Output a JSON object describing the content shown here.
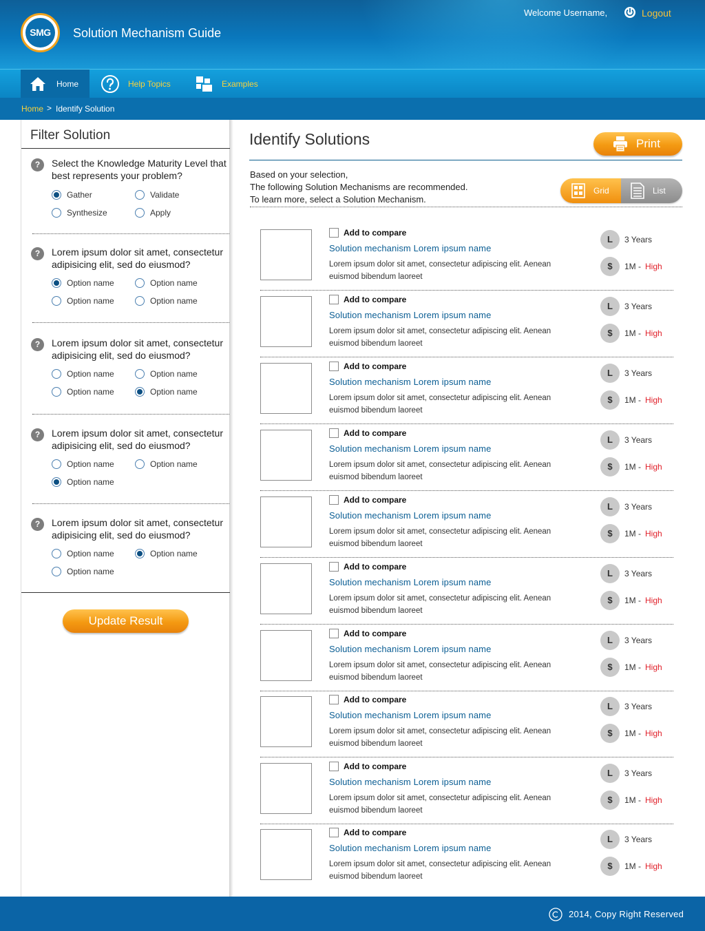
{
  "app": {
    "logo_text": "SMG",
    "title": "Solution Mechanism Guide",
    "welcome": "Welcome Username,",
    "logout": "Logout"
  },
  "nav": {
    "home": "Home",
    "help": "Help Topics",
    "examples": "Examples"
  },
  "breadcrumb": {
    "home": "Home",
    "separator": ">",
    "current": "Identify Solution"
  },
  "filter": {
    "title": "Filter Solution",
    "help_icon": "?",
    "questions": [
      {
        "text": "Select the Knowledge Maturity Level that best represents your problem?",
        "options": [
          {
            "label": "Gather",
            "selected": true
          },
          {
            "label": "Validate",
            "selected": false
          },
          {
            "label": "Synthesize",
            "selected": false
          },
          {
            "label": "Apply",
            "selected": false
          }
        ]
      },
      {
        "text": "Lorem ipsum dolor sit amet, consectetur adipisicing elit, sed do eiusmod?",
        "options": [
          {
            "label": "Option name",
            "selected": true
          },
          {
            "label": "Option name",
            "selected": false
          },
          {
            "label": "Option name",
            "selected": false
          },
          {
            "label": "Option name",
            "selected": false
          }
        ]
      },
      {
        "text": "Lorem ipsum dolor sit amet, consectetur adipisicing elit, sed do eiusmod?",
        "options": [
          {
            "label": "Option name",
            "selected": false
          },
          {
            "label": "Option name",
            "selected": false
          },
          {
            "label": "Option name",
            "selected": false
          },
          {
            "label": "Option name",
            "selected": true
          }
        ]
      },
      {
        "text": "Lorem ipsum dolor sit amet, consectetur adipisicing elit, sed do eiusmod?",
        "options": [
          {
            "label": "Option name",
            "selected": false
          },
          {
            "label": "Option name",
            "selected": false
          },
          {
            "label": "Option name",
            "selected": true
          }
        ]
      },
      {
        "text": "Lorem ipsum dolor sit amet, consectetur adipisicing elit, sed do eiusmod?",
        "options": [
          {
            "label": "Option name",
            "selected": false
          },
          {
            "label": "Option name",
            "selected": true
          },
          {
            "label": "Option name",
            "selected": false
          }
        ]
      }
    ],
    "update_button": "Update Result"
  },
  "main": {
    "title": "Identify Solutions",
    "print": "Print",
    "intro": [
      "Based on your selection,",
      "The following Solution Mechanisms are recommended.",
      "To learn more, select a Solution Mechanism."
    ],
    "view_grid": "Grid",
    "view_list": "List",
    "active_view": "Grid"
  },
  "results": [
    {
      "compare": "Add to compare",
      "title": "Solution mechanism Lorem ipsum name",
      "desc": "Lorem ipsum dolor sit amet, consectetur adipiscing elit. Aenean euismod bibendum laoreet",
      "duration": "3 Years",
      "cost": "1M -",
      "level": "High",
      "clock_glyph": "L",
      "cost_glyph": "$"
    },
    {
      "compare": "Add to compare",
      "title": "Solution mechanism Lorem ipsum name",
      "desc": "Lorem ipsum dolor sit amet, consectetur adipiscing elit. Aenean euismod bibendum laoreet",
      "duration": "3 Years",
      "cost": "1M -",
      "level": "High",
      "clock_glyph": "L",
      "cost_glyph": "$"
    },
    {
      "compare": "Add to compare",
      "title": "Solution mechanism Lorem ipsum name",
      "desc": "Lorem ipsum dolor sit amet, consectetur adipiscing elit. Aenean euismod bibendum laoreet",
      "duration": "3 Years",
      "cost": "1M -",
      "level": "High",
      "clock_glyph": "L",
      "cost_glyph": "$"
    },
    {
      "compare": "Add to compare",
      "title": "Solution mechanism Lorem ipsum name",
      "desc": "Lorem ipsum dolor sit amet, consectetur adipiscing elit. Aenean euismod bibendum laoreet",
      "duration": "3 Years",
      "cost": "1M -",
      "level": "High",
      "clock_glyph": "L",
      "cost_glyph": "$"
    },
    {
      "compare": "Add to compare",
      "title": "Solution mechanism Lorem ipsum name",
      "desc": "Lorem ipsum dolor sit amet, consectetur adipiscing elit. Aenean euismod bibendum laoreet",
      "duration": "3 Years",
      "cost": "1M -",
      "level": "High",
      "clock_glyph": "L",
      "cost_glyph": "$"
    },
    {
      "compare": "Add to compare",
      "title": "Solution mechanism Lorem ipsum name",
      "desc": "Lorem ipsum dolor sit amet, consectetur adipiscing elit. Aenean euismod bibendum laoreet",
      "duration": "3 Years",
      "cost": "1M -",
      "level": "High",
      "clock_glyph": "L",
      "cost_glyph": "$"
    },
    {
      "compare": "Add to compare",
      "title": "Solution mechanism Lorem ipsum name",
      "desc": "Lorem ipsum dolor sit amet, consectetur adipiscing elit. Aenean euismod bibendum laoreet",
      "duration": "3 Years",
      "cost": "1M -",
      "level": "High",
      "clock_glyph": "L",
      "cost_glyph": "$"
    },
    {
      "compare": "Add to compare",
      "title": "Solution mechanism Lorem ipsum name",
      "desc": "Lorem ipsum dolor sit amet, consectetur adipiscing elit. Aenean euismod bibendum laoreet",
      "duration": "3 Years",
      "cost": "1M -",
      "level": "High",
      "clock_glyph": "L",
      "cost_glyph": "$"
    },
    {
      "compare": "Add to compare",
      "title": "Solution mechanism Lorem ipsum name",
      "desc": "Lorem ipsum dolor sit amet, consectetur adipiscing elit. Aenean euismod bibendum laoreet",
      "duration": "3 Years",
      "cost": "1M -",
      "level": "High",
      "clock_glyph": "L",
      "cost_glyph": "$"
    },
    {
      "compare": "Add to compare",
      "title": "Solution mechanism Lorem ipsum name",
      "desc": "Lorem ipsum dolor sit amet, consectetur adipiscing elit. Aenean euismod bibendum laoreet",
      "duration": "3 Years",
      "cost": "1M -",
      "level": "High",
      "clock_glyph": "L",
      "cost_glyph": "$"
    }
  ],
  "footer": {
    "copyright": "2014, Copy Right Reserved"
  },
  "colors": {
    "header_blue": "#0a78bd",
    "nav_blue": "#0b85c4",
    "accent_orange": "#f49a12",
    "link_yellow": "#f7d23c",
    "link_blue": "#0b5e94",
    "high_red": "#e0202a"
  },
  "icons": [
    "power-icon",
    "home-icon",
    "help-icon",
    "examples-icon",
    "print-icon",
    "grid-icon",
    "list-icon",
    "clock-icon",
    "dollar-icon",
    "question-icon",
    "copyright-icon"
  ]
}
